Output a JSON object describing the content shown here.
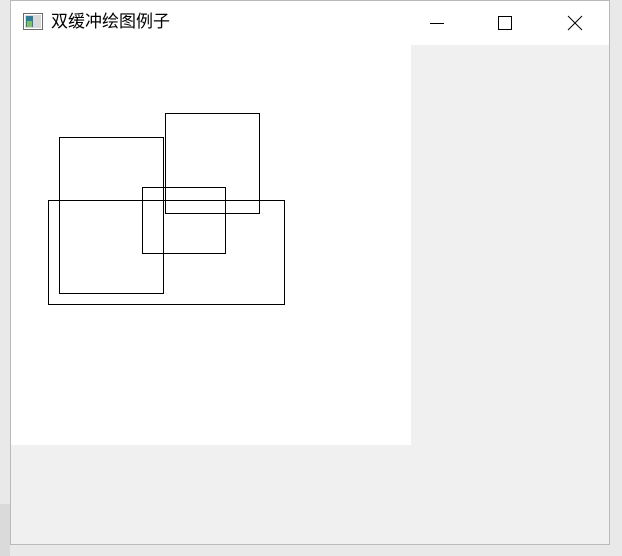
{
  "window": {
    "title": "双缓冲绘图例子",
    "background_color": "#f0f0f0",
    "titlebar_color": "#ffffff",
    "canvas_color": "#ffffff",
    "controls": {
      "minimize_icon": "minimize-icon",
      "maximize_icon": "maximize-icon",
      "close_icon": "close-icon"
    }
  },
  "drawing": {
    "shape": "rectangle-outline",
    "stroke_color": "#000000",
    "rectangle_count": 4
  }
}
